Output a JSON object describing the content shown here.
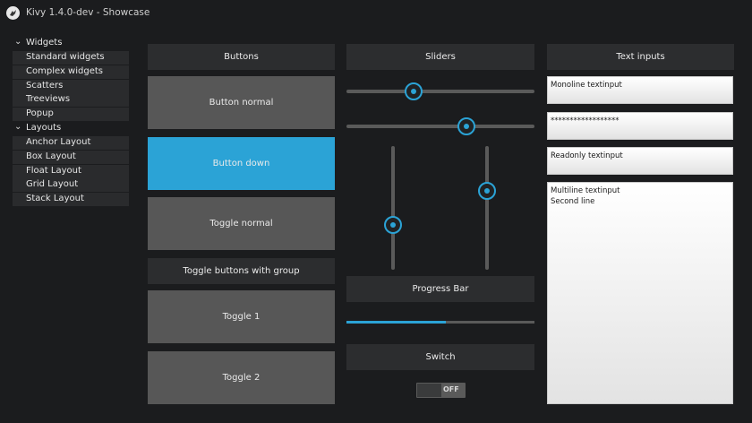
{
  "window": {
    "title": "Kivy 1.4.0-dev - Showcase"
  },
  "tree": {
    "groups": [
      {
        "label": "Widgets",
        "items": [
          "Standard widgets",
          "Complex widgets",
          "Scatters",
          "Treeviews",
          "Popup"
        ]
      },
      {
        "label": "Layouts",
        "items": [
          "Anchor Layout",
          "Box Layout",
          "Float Layout",
          "Grid Layout",
          "Stack Layout"
        ]
      }
    ]
  },
  "buttons": {
    "header": "Buttons",
    "normal": "Button normal",
    "down": "Button down",
    "toggle": "Toggle normal",
    "group_header": "Toggle buttons with group",
    "toggle1": "Toggle 1",
    "toggle2": "Toggle 2"
  },
  "sliders": {
    "header": "Sliders",
    "horizontal_values": [
      0.34,
      0.65
    ],
    "vertical_values": [
      0.34,
      0.66
    ]
  },
  "progress": {
    "header": "Progress Bar",
    "value": 0.53
  },
  "switch": {
    "header": "Switch",
    "state": "OFF"
  },
  "text_inputs": {
    "header": "Text inputs",
    "monoline": "Monoline textinput",
    "password": "******************",
    "readonly": "Readonly textinput",
    "multiline": [
      "Multiline textinput",
      "Second line"
    ]
  },
  "colors": {
    "accent": "#2ba3d6",
    "button": "#575757",
    "header": "#2c2d2f",
    "background": "#1b1c1e"
  }
}
